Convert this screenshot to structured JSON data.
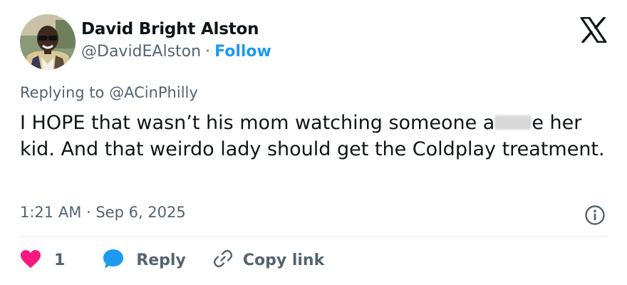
{
  "author": {
    "display_name": "David Bright Alston",
    "handle": "@DavidEAlston",
    "separator": "·",
    "follow_label": "Follow",
    "avatar_icon": "profile-photo"
  },
  "platform": {
    "logo_icon": "x-logo-icon"
  },
  "tweet": {
    "reply_prefix": "Replying to ",
    "reply_handle": "@ACinPhilly",
    "text_part1": "I HOPE that wasn’t his mom watching someone a",
    "text_part2": "e her kid. And that weirdo lady should get the Coldplay treatment.",
    "timestamp": "1:21 AM · Sep 6, 2025"
  },
  "actions": {
    "like_count": "1",
    "reply_label": "Reply",
    "copy_link_label": "Copy link"
  },
  "colors": {
    "accent": "#1d9bf0",
    "like": "#f91880",
    "muted_text": "#536471",
    "primary_text": "#0f1419"
  }
}
